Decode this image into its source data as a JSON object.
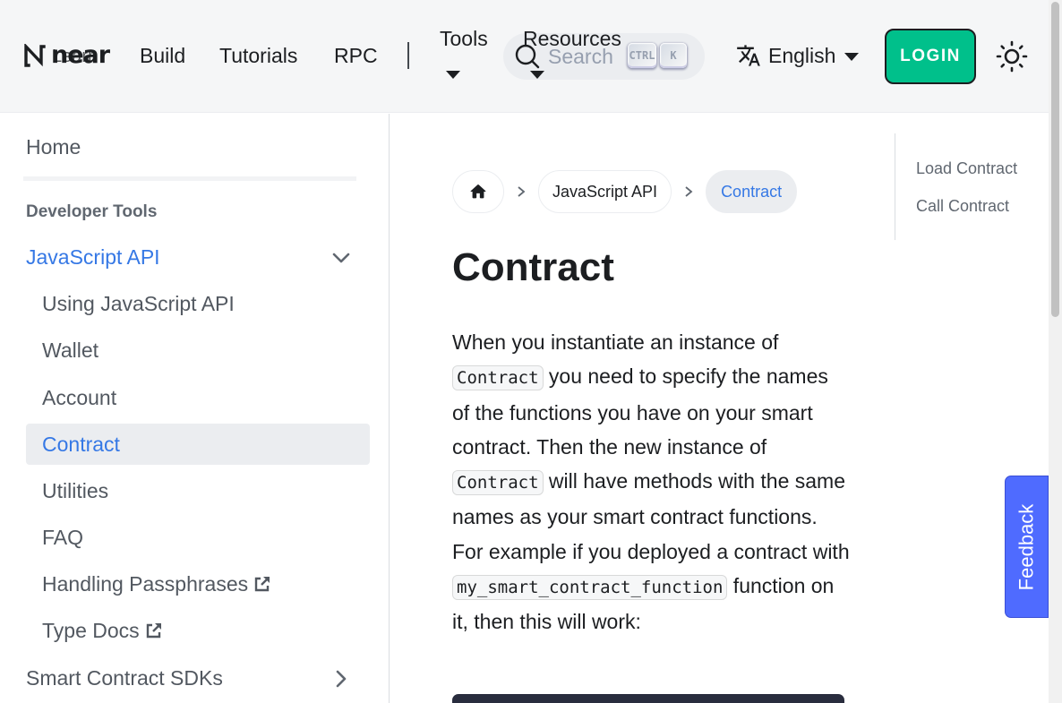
{
  "navbar": {
    "brand_word": "near",
    "brand_under": "Learn",
    "links": [
      "Build",
      "Tutorials",
      "RPC"
    ],
    "dropdowns": [
      "Tools",
      "Resources"
    ],
    "search_placeholder": "Search",
    "search_kbd": [
      "CTRL",
      "K"
    ],
    "language": "English",
    "login_label": "LOGIN"
  },
  "sidebar": {
    "home": "Home",
    "category": "Developer Tools",
    "active_parent": "JavaScript API",
    "items": [
      "Using JavaScript API",
      "Wallet",
      "Account",
      "Contract",
      "Utilities",
      "FAQ",
      "Handling Passphrases",
      "Type Docs"
    ],
    "active_item": "Contract",
    "next_category": "Smart Contract SDKs"
  },
  "breadcrumbs": {
    "middle": "JavaScript API",
    "current": "Contract"
  },
  "content": {
    "title": "Contract",
    "p_parts": [
      "When you instantiate an instance of ",
      "Contract",
      " you need to specify the names of the functions you have on your smart contract. Then the new instance of ",
      "Contract",
      " will have methods with the same names as your smart contract functions. For example if you deployed a contract with ",
      "my_smart_contract_function",
      " function on it, then this will work:"
    ]
  },
  "toc": {
    "items": [
      "Load Contract",
      "Call Contract"
    ]
  },
  "feedback": {
    "label": "Feedback"
  },
  "colors": {
    "accent": "#3578e5",
    "login": "#00c08b",
    "feedback": "#4f6bff"
  }
}
